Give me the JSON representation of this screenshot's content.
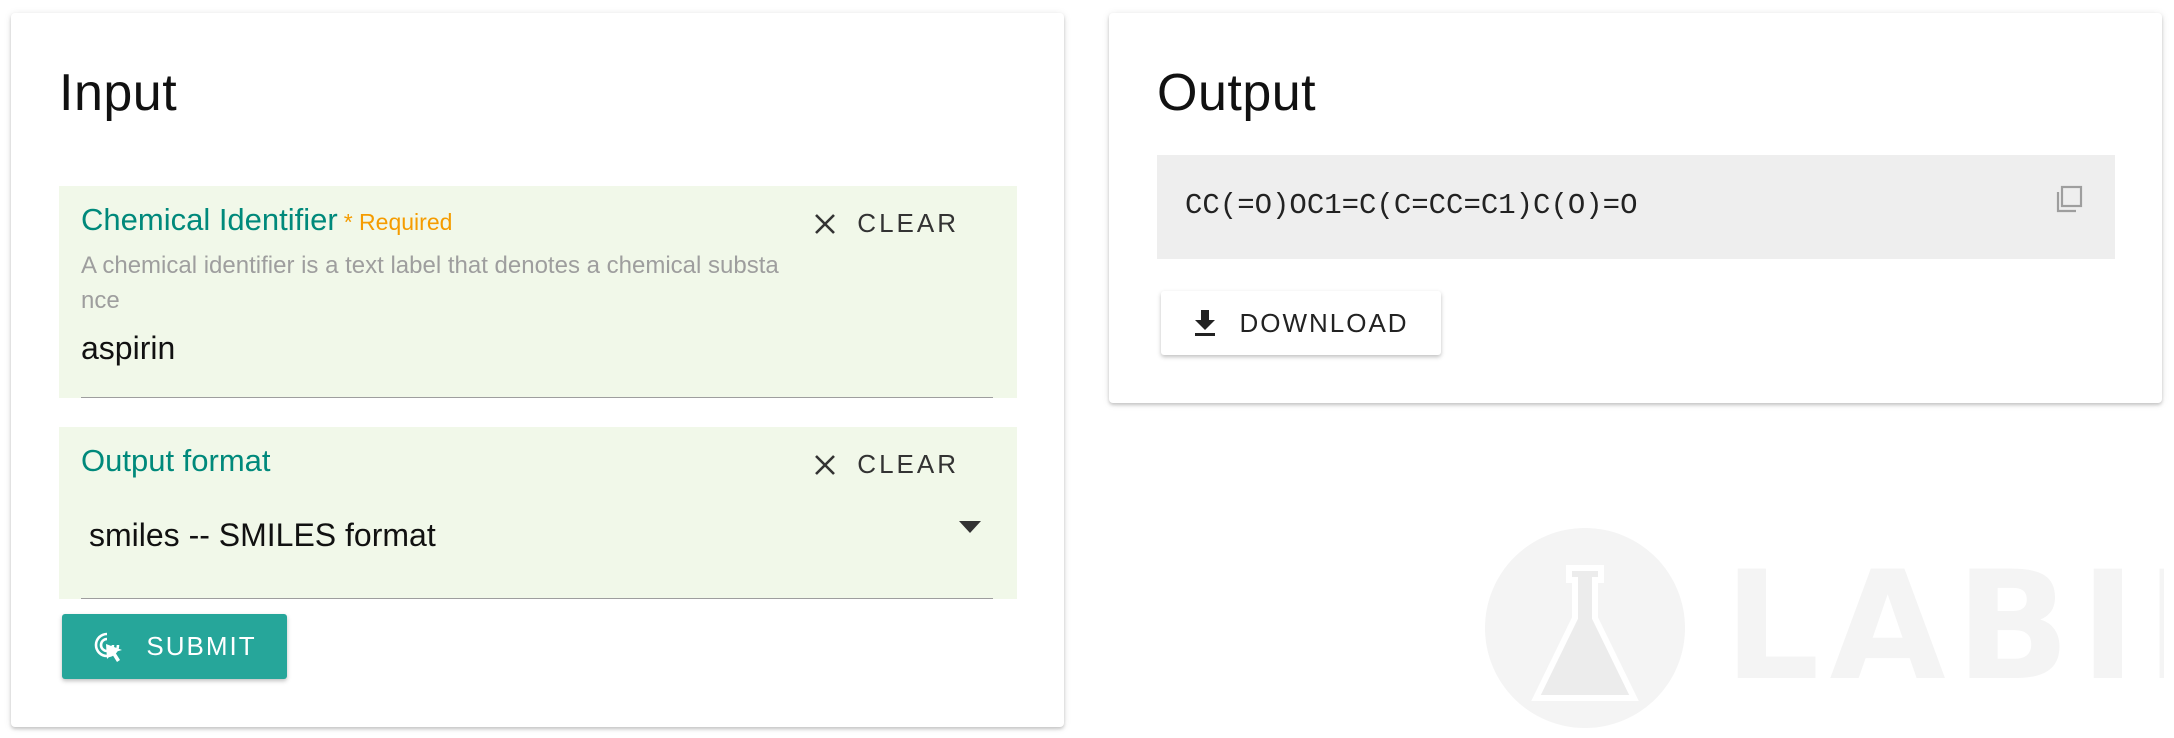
{
  "input_panel": {
    "title": "Input",
    "chemical_identifier": {
      "label": "Chemical Identifier",
      "required_label": "* Required",
      "hint": "A chemical identifier is a text label that denotes a chemical substance",
      "value": "aspirin",
      "clear_label": "CLEAR"
    },
    "output_format": {
      "label": "Output format",
      "selected": "smiles -- SMILES format",
      "clear_label": "CLEAR"
    },
    "submit_label": "SUBMIT"
  },
  "output_panel": {
    "title": "Output",
    "result": "CC(=O)OC1=C(C=CC=C1)C(O)=O",
    "download_label": "DOWNLOAD"
  },
  "watermark": {
    "text": "LABII",
    "icon": "flask-icon"
  },
  "colors": {
    "accent": "#26a69a",
    "label": "#00897b",
    "required": "#f59c00",
    "field_background": "#f1f8e9",
    "output_background": "#eeeeee"
  }
}
